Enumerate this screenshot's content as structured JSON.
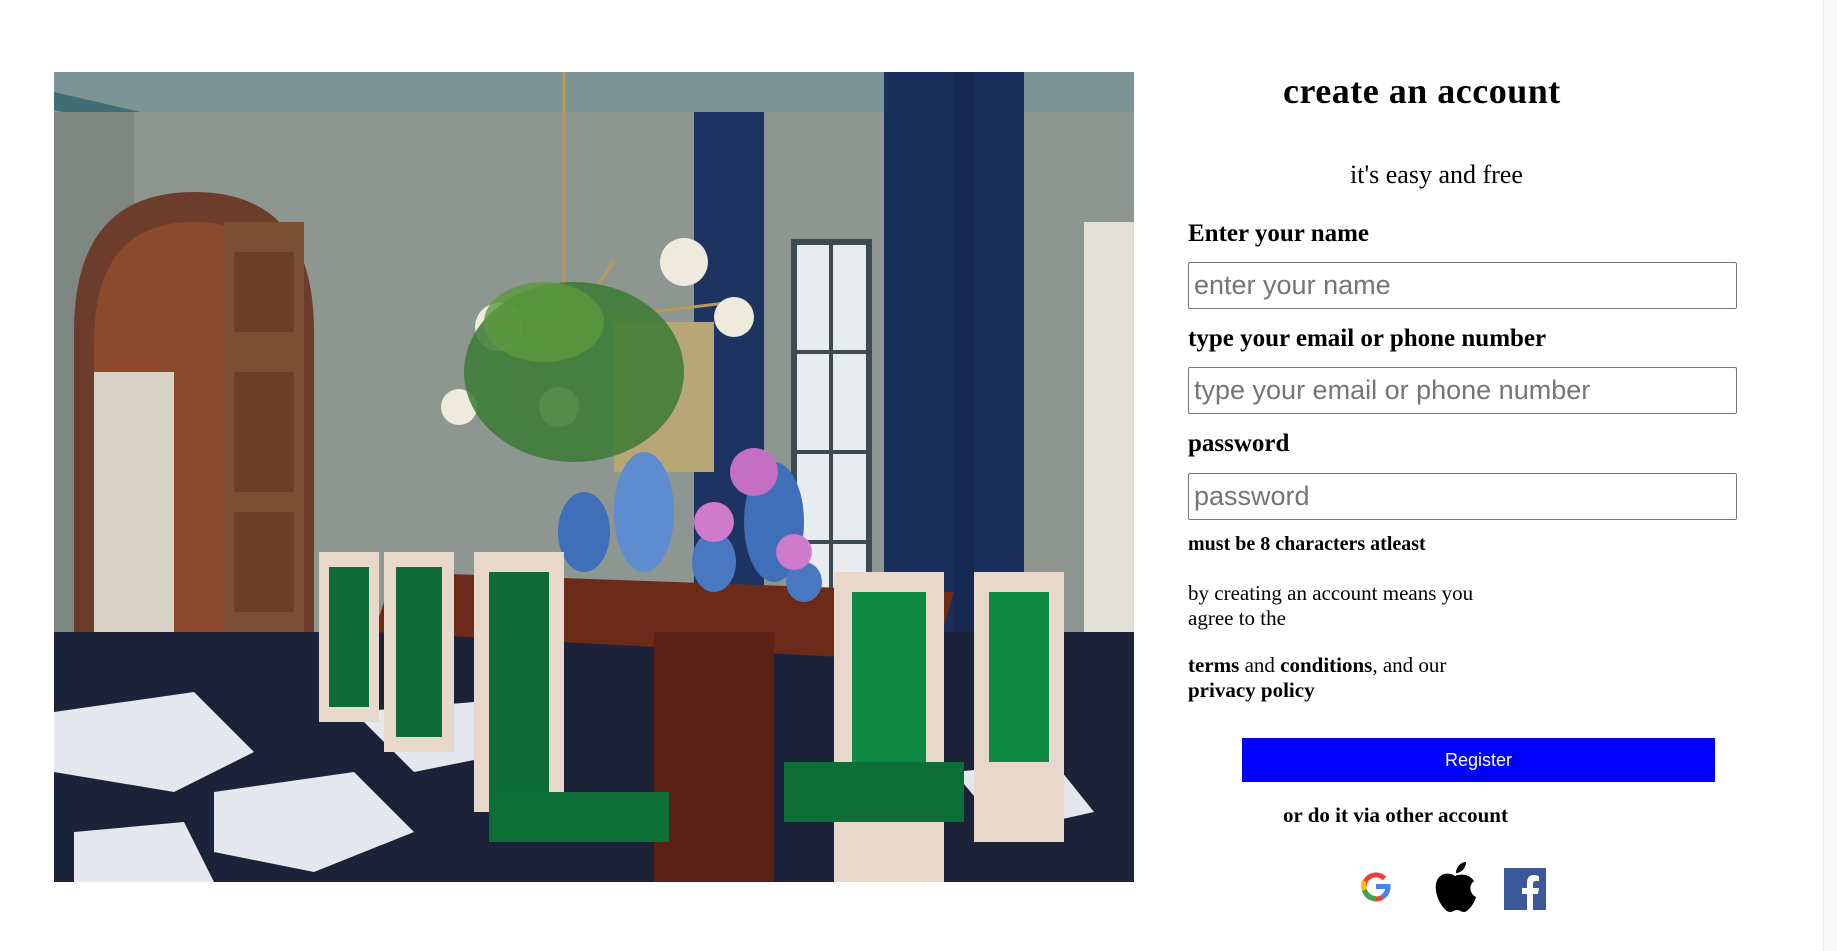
{
  "form": {
    "title": "create an account",
    "subtitle": "it's easy and free",
    "name_label": "Enter your name",
    "name_placeholder": "enter your name",
    "name_value": "",
    "contact_label": "type your email or phone number",
    "contact_placeholder": "type your email or phone number",
    "contact_value": "",
    "password_label": "password",
    "password_placeholder": "password",
    "password_value": "",
    "password_hint": "must be 8 characters atleast",
    "consent_text": "by creating an account means you agree to the",
    "terms": {
      "terms_word": "terms",
      "and_word": "and",
      "conditions_word": "conditions",
      "and_our": ", and our",
      "privacy_policy": "privacy policy"
    },
    "register_label": "Register",
    "alt_text": "or do it via other account"
  },
  "hero": {
    "icon": "dining-room-photo"
  },
  "social": [
    {
      "icon": "google-icon",
      "color": "#4285F4"
    },
    {
      "icon": "apple-icon",
      "color": "#000000"
    },
    {
      "icon": "facebook-icon",
      "color": "#3B5998"
    }
  ],
  "colors": {
    "accent": "#0000FF",
    "background": "#FFFFFF"
  }
}
